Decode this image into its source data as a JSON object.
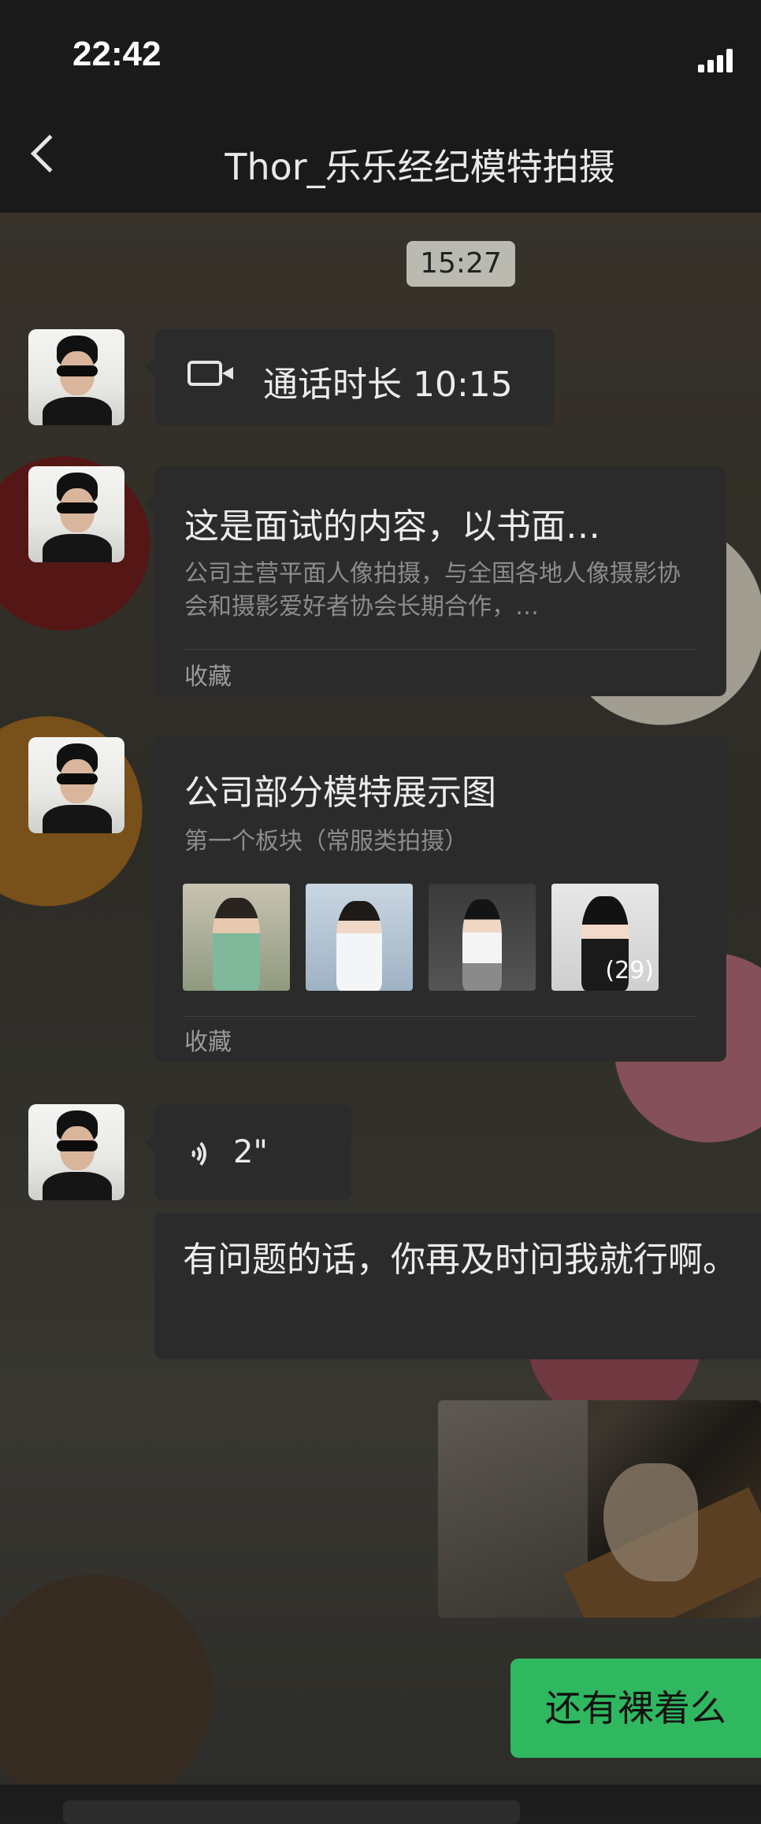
{
  "status": {
    "time": "22:42"
  },
  "header": {
    "title": "Thor_乐乐经纪模特拍摄"
  },
  "chat": {
    "timestamp": "15:27",
    "call": {
      "label": "通话时长 10:15"
    },
    "fav1": {
      "title": "这是面试的内容，以书面…",
      "desc": "公司主营平面人像拍摄，与全国各地人像摄影协会和摄影爱好者协会长期合作，…",
      "footer": "收藏"
    },
    "fav2": {
      "title": "公司部分模特展示图",
      "desc": "第一个板块（常服类拍摄）",
      "more_count": "(29)",
      "footer": "收藏"
    },
    "voice": {
      "duration": "2\""
    },
    "text1": "有问题的话，你再及时问我就行啊。",
    "reply": "还有裸着么"
  },
  "colors": {
    "accent_green": "#2fb860",
    "bubble": "#2b2b2b"
  },
  "icons": [
    "back-icon",
    "video-call-icon",
    "voice-icon",
    "signal-icon"
  ]
}
